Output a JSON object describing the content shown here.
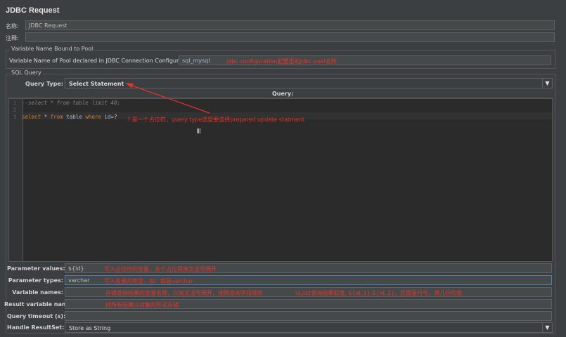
{
  "title": "JDBC Request",
  "name_label": "名称:",
  "name_value": "JDBC Request",
  "comment_label": "注释:",
  "comment_value": "",
  "pool_group_title": "Variable Name Bound to Pool",
  "pool_label": "Variable Name of Pool declared in JDBC Connection Configuration:",
  "pool_value": "sql_mysql",
  "pool_annotation": "jdbc configuration配置里的jdbc pool名称",
  "sql_group_title": "SQL Query",
  "query_type_label": "Query Type:",
  "query_type_value": "Select Statement",
  "query_header": "Query:",
  "code_lines": [
    {
      "num": "1",
      "text": "--select * from table limit 40;"
    },
    {
      "num": "2",
      "text": ""
    },
    {
      "num": "3",
      "text": "select * from table where id=?"
    }
  ],
  "code_line3": {
    "kw1": "select",
    "plain1": " * ",
    "kw2": "from",
    "plain2": " table ",
    "kw3": "where",
    "plain3": " id=",
    "q": "?"
  },
  "query_annotation": "?  是一个占位符，query type选型要选择prepared update statment",
  "params": [
    {
      "label": "Parameter values:",
      "value": "${id}",
      "annotation": "写入占位符的变量，多个占位用英文逗号隔开"
    },
    {
      "label": "Parameter types:",
      "value": "varchar",
      "annotation": "写入变量的类型，如：都是varchar"
    },
    {
      "label": "Variable names:",
      "value": "",
      "annotation": "存储查询结果的变量名称，以英文逗号隔开，按照查询字段顺序",
      "annotation2": "id,id2查询结果取值, ${id_1},${id_2}，后面是行号，第几行的值"
    },
    {
      "label": "Result variable name:",
      "value": "",
      "annotation": "把所有结果以对象的形式存储"
    },
    {
      "label": "Query timeout (s):",
      "value": "",
      "annotation": ""
    }
  ],
  "handle_label": "Handle ResultSet:",
  "handle_value": "Store as String"
}
